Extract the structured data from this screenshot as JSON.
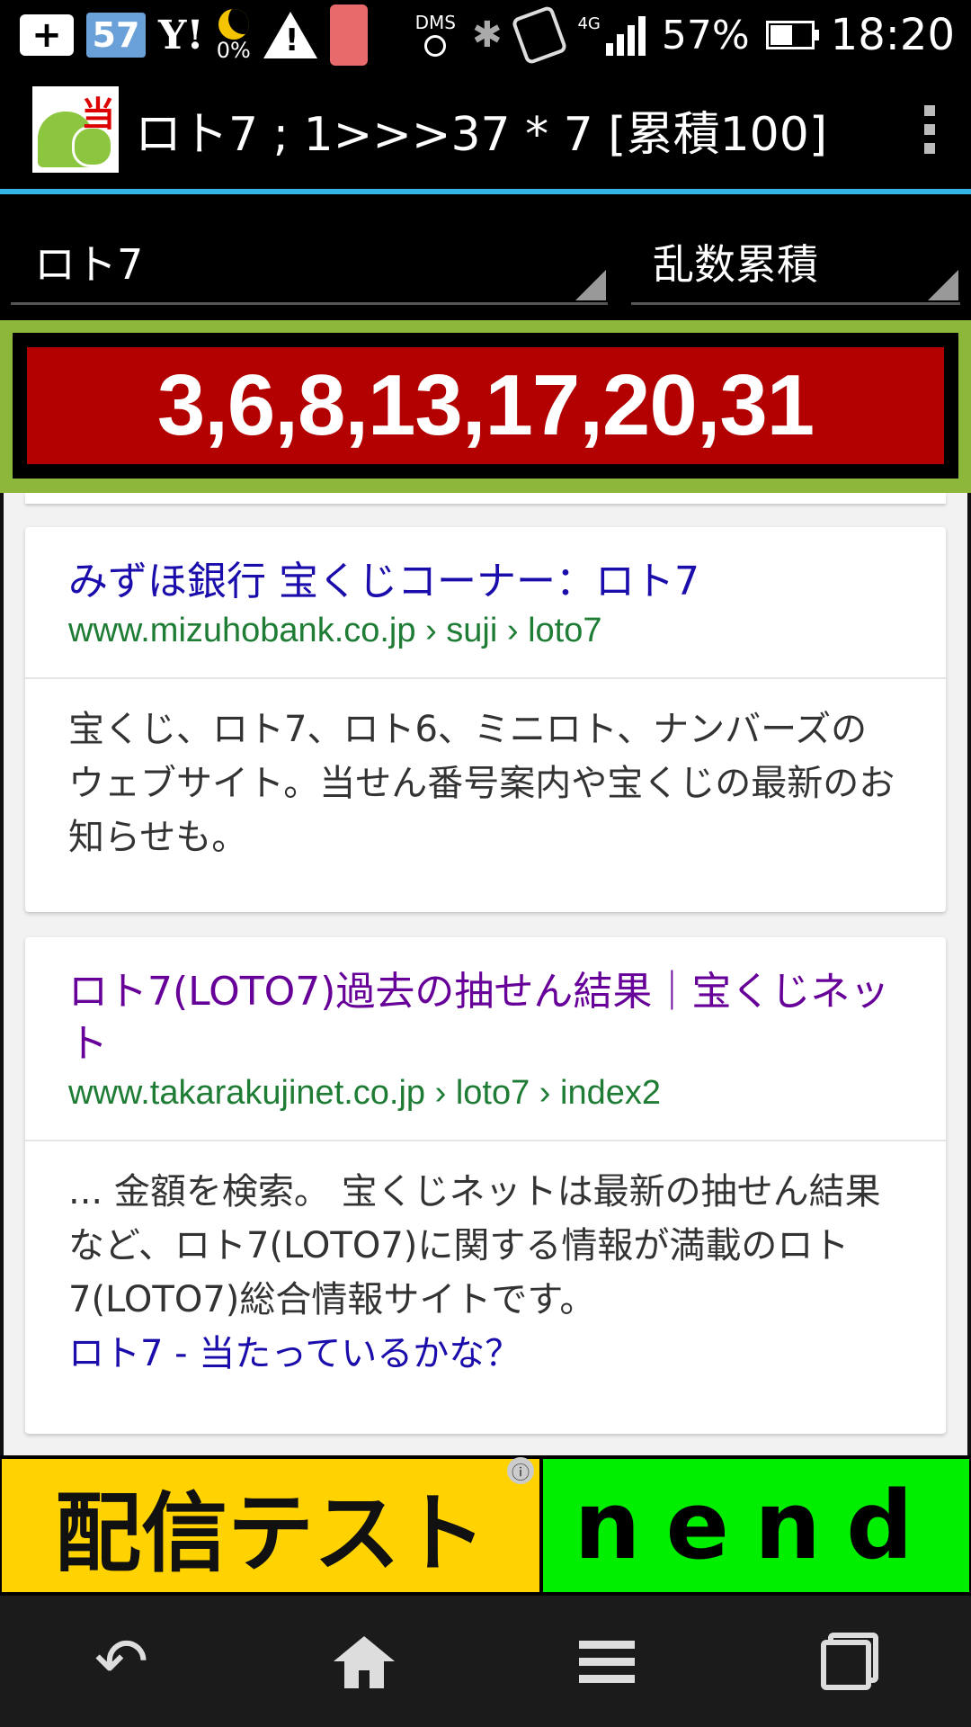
{
  "status_bar": {
    "moon_percent": "0%",
    "dms_label": "DMS",
    "network": "4G",
    "battery_percent": "57%",
    "time": "18:20",
    "num_badge": "57",
    "yahoo": "Y!"
  },
  "action_bar": {
    "icon_kanji": "当",
    "title": "ロト7 ; 1>>>37 * 7 [累積100]"
  },
  "spinners": {
    "game": "ロト7",
    "mode": "乱数累積"
  },
  "result": {
    "numbers": "3,6,8,13,17,20,31",
    "colors": {
      "banner": "#b30000",
      "frame": "#8cb73a"
    }
  },
  "search_results": [
    {
      "title": "みずほ銀行 宝くじコーナー：ロト7",
      "url": "www.mizuhobank.co.jp › suji › loto7",
      "snippet": "宝くじ、ロト7、ロト6、ミニロト、ナンバーズのウェブサイト。当せん番号案内や宝くじの最新のお知らせも。",
      "visited": false
    },
    {
      "title": "ロト7(LOTO7)過去の抽せん結果｜宝くじネット",
      "url": "www.takarakujinet.co.jp › loto7 › index2",
      "snippet": "... 金額を検索。 宝くじネットは最新の抽せん結果など、ロト7(LOTO7)に関する情報が満載のロト7(LOTO7)総合情報サイトです。",
      "extra_link": "ロト7 - 当たっているかな？",
      "visited": true
    }
  ],
  "ad": {
    "left_text": "配信テスト",
    "right_text": "nend",
    "info_icon": "ⓘ"
  },
  "nav_bar": {
    "icons": [
      "back-icon",
      "home-icon",
      "menu-icon",
      "recents-icon"
    ]
  }
}
